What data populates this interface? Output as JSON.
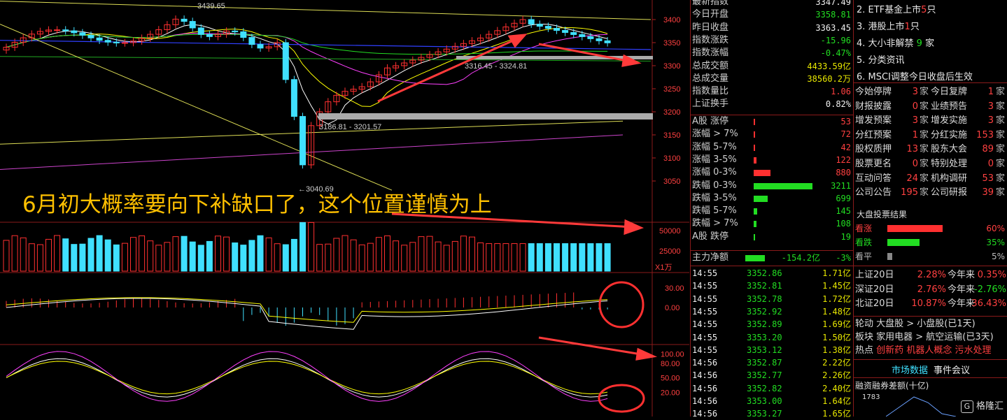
{
  "chart": {
    "y_ticks": [
      {
        "label": "3400",
        "v": 3400
      },
      {
        "label": "3350",
        "v": 3350
      },
      {
        "label": "3300",
        "v": 3300
      },
      {
        "label": "3250",
        "v": 3250
      },
      {
        "label": "3200",
        "v": 3200
      },
      {
        "label": "3150",
        "v": 3150
      },
      {
        "label": "3100",
        "v": 3100
      },
      {
        "label": "3050",
        "v": 3050
      }
    ],
    "vol_ticks": [
      {
        "label": "50000",
        "v": 50000
      },
      {
        "label": "25000",
        "v": 25000
      }
    ],
    "vol_unit": "X1万",
    "macd_ticks": [
      {
        "label": "30.00",
        "v": 30
      },
      {
        "label": "0.00",
        "v": 0
      }
    ],
    "kdj_ticks": [
      {
        "label": "100.00",
        "v": 100
      },
      {
        "label": "80.00",
        "v": 80
      },
      {
        "label": "50.00",
        "v": 50
      },
      {
        "label": "20.00",
        "v": 20
      }
    ],
    "price_labels": {
      "top": "3439.65",
      "mid": "3316.45 - 3324.81",
      "gap": "3186.81 - 3201.57",
      "low": "←3040.69"
    },
    "annotation": "6月初大概率要向下补缺口了，这个位置谨慎为上"
  },
  "quote": {
    "rows": [
      {
        "label": "最新指数",
        "value": "3347.49",
        "cls": "white"
      },
      {
        "label": "今日开盘",
        "value": "3358.81",
        "cls": "green"
      },
      {
        "label": "昨日收盘",
        "value": "3363.45",
        "cls": "white"
      },
      {
        "label": "指数涨跌",
        "value": "-15.96",
        "cls": "green"
      },
      {
        "label": "指数涨幅",
        "value": "-0.47%",
        "cls": "green"
      },
      {
        "label": "总成交额",
        "value": "4433.59亿",
        "cls": "yellow"
      },
      {
        "label": "总成交量",
        "value": "38560.2万",
        "cls": "yellow"
      },
      {
        "label": "指数量比",
        "value": "1.06",
        "cls": "red"
      },
      {
        "label": "上证换手",
        "value": "0.82%",
        "cls": "white"
      }
    ],
    "breadth": [
      {
        "label": "A股 涨停",
        "value": "53",
        "cls": "red",
        "bar": 2,
        "bcolor": "#ff3030"
      },
      {
        "label": "涨幅 > 7%",
        "value": "72",
        "cls": "red",
        "bar": 2,
        "bcolor": "#ff3030"
      },
      {
        "label": "涨幅 5-7%",
        "value": "42",
        "cls": "red",
        "bar": 2,
        "bcolor": "#ff3030"
      },
      {
        "label": "涨幅 3-5%",
        "value": "122",
        "cls": "red",
        "bar": 4,
        "bcolor": "#ff3030"
      },
      {
        "label": "涨幅 0-3%",
        "value": "880",
        "cls": "red",
        "bar": 24,
        "bcolor": "#ff3030"
      },
      {
        "label": "跌幅 0-3%",
        "value": "3211",
        "cls": "green",
        "bar": 84,
        "bcolor": "#22dd22"
      },
      {
        "label": "跌幅 3-5%",
        "value": "699",
        "cls": "green",
        "bar": 20,
        "bcolor": "#22dd22"
      },
      {
        "label": "跌幅 5-7%",
        "value": "145",
        "cls": "green",
        "bar": 5,
        "bcolor": "#22dd22"
      },
      {
        "label": "跌幅 > 7%",
        "value": "108",
        "cls": "green",
        "bar": 4,
        "bcolor": "#22dd22"
      },
      {
        "label": "A股 跌停",
        "value": "19",
        "cls": "green",
        "bar": 2,
        "bcolor": "#22dd22"
      }
    ],
    "main_flow": {
      "label": "主力净额",
      "value": "-154.2亿",
      "pct": "-3%"
    },
    "ticks": [
      {
        "t": "14:55",
        "p": "3352.86",
        "a": "1.71亿"
      },
      {
        "t": "14:55",
        "p": "3352.81",
        "a": "1.45亿"
      },
      {
        "t": "14:55",
        "p": "3352.78",
        "a": "1.72亿"
      },
      {
        "t": "14:55",
        "p": "3352.92",
        "a": "1.48亿"
      },
      {
        "t": "14:55",
        "p": "3352.89",
        "a": "1.69亿"
      },
      {
        "t": "14:55",
        "p": "3353.20",
        "a": "1.50亿"
      },
      {
        "t": "14:55",
        "p": "3353.12",
        "a": "1.38亿"
      },
      {
        "t": "14:56",
        "p": "3352.87",
        "a": "2.22亿"
      },
      {
        "t": "14:56",
        "p": "3352.77",
        "a": "2.26亿"
      },
      {
        "t": "14:56",
        "p": "3352.82",
        "a": "2.40亿"
      },
      {
        "t": "14:56",
        "p": "3353.00",
        "a": "1.64亿"
      },
      {
        "t": "14:56",
        "p": "3353.27",
        "a": "1.65亿"
      }
    ]
  },
  "side": {
    "news": [
      {
        "text": "2. ETF基金上市",
        "num": "5",
        "tail": "只"
      },
      {
        "text": "3. 港股上市",
        "num": "1",
        "tail": "只"
      },
      {
        "text": "4. 大小非解禁 ",
        "num": "9",
        "tail": " 家"
      },
      {
        "text": "5. 分类资讯",
        "num": "",
        "tail": ""
      },
      {
        "text": "6. MSCI调整今日收盘后生效",
        "num": "",
        "tail": ""
      }
    ],
    "events": [
      [
        "今始停牌",
        "3",
        "今日复牌",
        "1"
      ],
      [
        "财报披露",
        "0",
        "业绩预告",
        "3"
      ],
      [
        "增发预案",
        "3",
        "增发实施",
        "3"
      ],
      [
        "分红预案",
        "1",
        "分红实施",
        "153"
      ],
      [
        "股权质押",
        "13",
        "股东大会",
        "89"
      ],
      [
        "股票更名",
        "0",
        "特别处理",
        "0"
      ],
      [
        "互动问答",
        "24",
        "机构调研",
        "53"
      ],
      [
        "公司公告",
        "195",
        "公司研报",
        "39"
      ]
    ],
    "unit": "家",
    "vote_title": "大盘投票结果",
    "votes": [
      {
        "label": "看涨",
        "pct": "60%",
        "frac": 0.6,
        "color": "#ff3030"
      },
      {
        "label": "看跌",
        "pct": "35%",
        "frac": 0.35,
        "color": "#22dd22"
      },
      {
        "label": "看平",
        "pct": "5%",
        "frac": 0.05,
        "color": "#888"
      }
    ],
    "perf": [
      {
        "label": "上证20日",
        "a": "2.28%",
        "b_label": "今年来",
        "b": "0.35%",
        "acls": "red",
        "bcls": "red"
      },
      {
        "label": "深证20日",
        "a": "2.76%",
        "b_label": "今年来",
        "b": "-2.76%",
        "acls": "red",
        "bcls": "green"
      },
      {
        "label": "北证20日",
        "a": "10.87%",
        "b_label": "今年来",
        "b": "36.43%",
        "acls": "red",
        "bcls": "red"
      }
    ],
    "rotation": "轮动 大盘股 > 小盘股(已1天)",
    "sector": "板块 家用电器 > 航空运输(已3天)",
    "hot_label": "热点",
    "hot": [
      "创新药",
      "机器人概念",
      "污水处理"
    ],
    "tabs": [
      "市场数据",
      "事件会议"
    ],
    "margin_title": "融资融券差额(十亿)",
    "margin_tick": "1783",
    "logo": "格隆汇"
  }
}
